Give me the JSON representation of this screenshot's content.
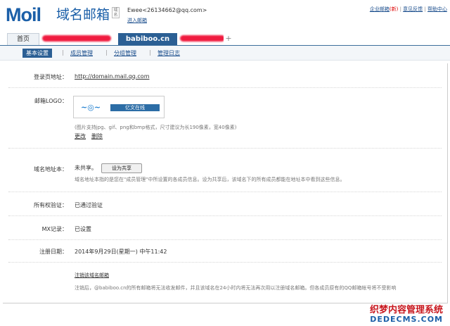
{
  "brand": {
    "logo": "Moil",
    "title": "域名邮箱",
    "subtitle": "域名"
  },
  "user": {
    "name": "Ewee",
    "email": "<26134662@qq.com>",
    "enter_mail": "进入邮箱"
  },
  "top_links": {
    "enterprise": "企业邮箱",
    "new_badge": "(新)",
    "feedback": "意见反馈",
    "help": "帮助中心",
    "sep": "|"
  },
  "tabs": {
    "home": "首页",
    "active": "babiboo.cn",
    "add": "+"
  },
  "subnav": {
    "basic": "基本设置",
    "members": "成员管理",
    "groups": "分组管理",
    "log": "管理日志",
    "sep": "|"
  },
  "fields": {
    "login_label": "登录页地址：",
    "login_url": "http://domain.mail.qq.com",
    "logo_label": "邮箱LOGO：",
    "logo_image_text": "亿文在线",
    "logo_hint": "(图片支持jpg、gif、png和bmp格式，尺寸建议为长190像素，宽40像素)",
    "logo_change": "更改",
    "logo_delete": "删除",
    "addrbook_label": "域名地址本：",
    "addrbook_status": "未共享。",
    "addrbook_button": "设为共享",
    "addrbook_desc": "域名地址本指的是您在\"成员管理\"中所设置的各成员信息。设为共享后，该域名下的所有成员都能在地址本中看到这些信息。",
    "owner_label": "所有权验证：",
    "owner_value": "已通过验证",
    "mx_label": "MX记录：",
    "mx_value": "已设置",
    "reg_label": "注册日期：",
    "reg_value": "2014年9月29日(星期一) 中午11:42",
    "cancel_link": "注销该域名邮箱",
    "cancel_desc": "注销后，@babiboo.cn的所有邮箱将无法收发邮件，并且该域名在24小时内将无法再次用以注册域名邮箱。但各成员原有的QQ邮箱帐号将不受影响"
  },
  "watermark": {
    "line1": "织梦内容管理系统",
    "line2": "DEDECMS.COM"
  },
  "colors": {
    "accent": "#2b5f94",
    "link": "#1a4d8c",
    "redacted": "#f01b3f"
  }
}
